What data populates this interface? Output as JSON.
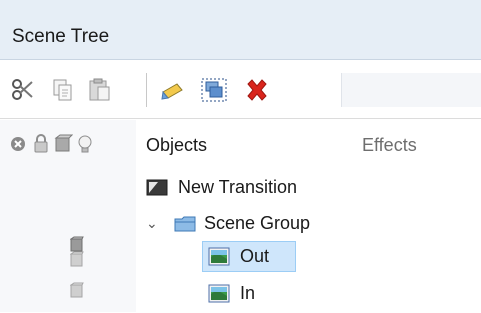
{
  "window": {
    "title": "Scene Tree"
  },
  "toolbar": {
    "buttons": [
      {
        "name": "cut",
        "icon": "scissors-icon"
      },
      {
        "name": "copy",
        "icon": "copy-icon"
      },
      {
        "name": "paste",
        "icon": "paste-icon"
      },
      {
        "name": "rename",
        "icon": "pencil-icon"
      },
      {
        "name": "group",
        "icon": "group-icon"
      },
      {
        "name": "delete",
        "icon": "red-x-icon"
      }
    ]
  },
  "columns": {
    "icons": [
      "close-circle-icon",
      "lock-icon",
      "cube-icon",
      "lightbulb-icon"
    ],
    "objects_label": "Objects",
    "effects_label": "Effects"
  },
  "tree": {
    "items": [
      {
        "label": "New Transition",
        "icon": "transition-icon",
        "depth": 0,
        "selected": false
      },
      {
        "label": "Scene Group",
        "icon": "folder-icon",
        "depth": 0,
        "expanded": true,
        "selected": false
      },
      {
        "label": "Out",
        "icon": "image-icon",
        "depth": 1,
        "selected": true
      },
      {
        "label": "In",
        "icon": "image-icon",
        "depth": 1,
        "selected": false
      }
    ]
  },
  "colors": {
    "title_bg": "#e6eef6",
    "selection_bg": "#cfe6fb",
    "delete_red": "#d9241c"
  }
}
